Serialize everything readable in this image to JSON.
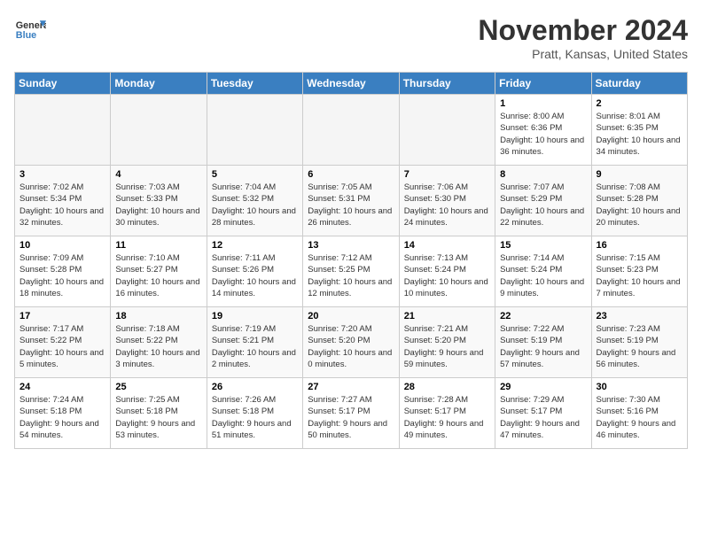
{
  "header": {
    "logo_line1": "General",
    "logo_line2": "Blue",
    "month": "November 2024",
    "location": "Pratt, Kansas, United States"
  },
  "weekdays": [
    "Sunday",
    "Monday",
    "Tuesday",
    "Wednesday",
    "Thursday",
    "Friday",
    "Saturday"
  ],
  "weeks": [
    [
      {
        "day": "",
        "info": ""
      },
      {
        "day": "",
        "info": ""
      },
      {
        "day": "",
        "info": ""
      },
      {
        "day": "",
        "info": ""
      },
      {
        "day": "",
        "info": ""
      },
      {
        "day": "1",
        "info": "Sunrise: 8:00 AM\nSunset: 6:36 PM\nDaylight: 10 hours and 36 minutes."
      },
      {
        "day": "2",
        "info": "Sunrise: 8:01 AM\nSunset: 6:35 PM\nDaylight: 10 hours and 34 minutes."
      }
    ],
    [
      {
        "day": "3",
        "info": "Sunrise: 7:02 AM\nSunset: 5:34 PM\nDaylight: 10 hours and 32 minutes."
      },
      {
        "day": "4",
        "info": "Sunrise: 7:03 AM\nSunset: 5:33 PM\nDaylight: 10 hours and 30 minutes."
      },
      {
        "day": "5",
        "info": "Sunrise: 7:04 AM\nSunset: 5:32 PM\nDaylight: 10 hours and 28 minutes."
      },
      {
        "day": "6",
        "info": "Sunrise: 7:05 AM\nSunset: 5:31 PM\nDaylight: 10 hours and 26 minutes."
      },
      {
        "day": "7",
        "info": "Sunrise: 7:06 AM\nSunset: 5:30 PM\nDaylight: 10 hours and 24 minutes."
      },
      {
        "day": "8",
        "info": "Sunrise: 7:07 AM\nSunset: 5:29 PM\nDaylight: 10 hours and 22 minutes."
      },
      {
        "day": "9",
        "info": "Sunrise: 7:08 AM\nSunset: 5:28 PM\nDaylight: 10 hours and 20 minutes."
      }
    ],
    [
      {
        "day": "10",
        "info": "Sunrise: 7:09 AM\nSunset: 5:28 PM\nDaylight: 10 hours and 18 minutes."
      },
      {
        "day": "11",
        "info": "Sunrise: 7:10 AM\nSunset: 5:27 PM\nDaylight: 10 hours and 16 minutes."
      },
      {
        "day": "12",
        "info": "Sunrise: 7:11 AM\nSunset: 5:26 PM\nDaylight: 10 hours and 14 minutes."
      },
      {
        "day": "13",
        "info": "Sunrise: 7:12 AM\nSunset: 5:25 PM\nDaylight: 10 hours and 12 minutes."
      },
      {
        "day": "14",
        "info": "Sunrise: 7:13 AM\nSunset: 5:24 PM\nDaylight: 10 hours and 10 minutes."
      },
      {
        "day": "15",
        "info": "Sunrise: 7:14 AM\nSunset: 5:24 PM\nDaylight: 10 hours and 9 minutes."
      },
      {
        "day": "16",
        "info": "Sunrise: 7:15 AM\nSunset: 5:23 PM\nDaylight: 10 hours and 7 minutes."
      }
    ],
    [
      {
        "day": "17",
        "info": "Sunrise: 7:17 AM\nSunset: 5:22 PM\nDaylight: 10 hours and 5 minutes."
      },
      {
        "day": "18",
        "info": "Sunrise: 7:18 AM\nSunset: 5:22 PM\nDaylight: 10 hours and 3 minutes."
      },
      {
        "day": "19",
        "info": "Sunrise: 7:19 AM\nSunset: 5:21 PM\nDaylight: 10 hours and 2 minutes."
      },
      {
        "day": "20",
        "info": "Sunrise: 7:20 AM\nSunset: 5:20 PM\nDaylight: 10 hours and 0 minutes."
      },
      {
        "day": "21",
        "info": "Sunrise: 7:21 AM\nSunset: 5:20 PM\nDaylight: 9 hours and 59 minutes."
      },
      {
        "day": "22",
        "info": "Sunrise: 7:22 AM\nSunset: 5:19 PM\nDaylight: 9 hours and 57 minutes."
      },
      {
        "day": "23",
        "info": "Sunrise: 7:23 AM\nSunset: 5:19 PM\nDaylight: 9 hours and 56 minutes."
      }
    ],
    [
      {
        "day": "24",
        "info": "Sunrise: 7:24 AM\nSunset: 5:18 PM\nDaylight: 9 hours and 54 minutes."
      },
      {
        "day": "25",
        "info": "Sunrise: 7:25 AM\nSunset: 5:18 PM\nDaylight: 9 hours and 53 minutes."
      },
      {
        "day": "26",
        "info": "Sunrise: 7:26 AM\nSunset: 5:18 PM\nDaylight: 9 hours and 51 minutes."
      },
      {
        "day": "27",
        "info": "Sunrise: 7:27 AM\nSunset: 5:17 PM\nDaylight: 9 hours and 50 minutes."
      },
      {
        "day": "28",
        "info": "Sunrise: 7:28 AM\nSunset: 5:17 PM\nDaylight: 9 hours and 49 minutes."
      },
      {
        "day": "29",
        "info": "Sunrise: 7:29 AM\nSunset: 5:17 PM\nDaylight: 9 hours and 47 minutes."
      },
      {
        "day": "30",
        "info": "Sunrise: 7:30 AM\nSunset: 5:16 PM\nDaylight: 9 hours and 46 minutes."
      }
    ]
  ]
}
